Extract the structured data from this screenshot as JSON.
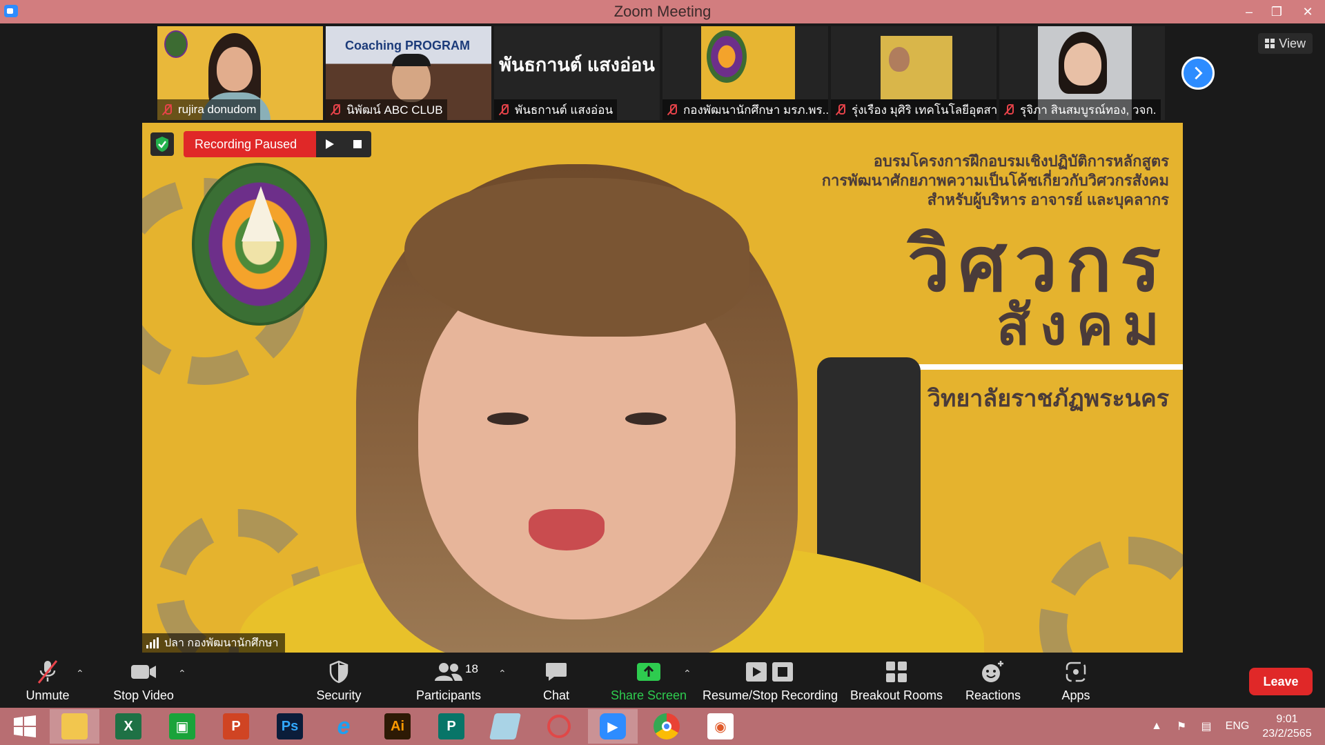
{
  "window": {
    "title": "Zoom Meeting"
  },
  "gallery": {
    "participants": [
      {
        "name": "rujira donudom"
      },
      {
        "name": "นิพัฒน์ ABC CLUB",
        "tile_text": "Coaching PROGRAM"
      },
      {
        "name": "พันธกานต์ แสงอ่อน",
        "big_name": "พันธกานต์ แสงอ่อน"
      },
      {
        "name": "กองพัฒนานักศึกษา มรภ.พร..."
      },
      {
        "name": "รุ่งเรือง มุศิริ เทคโนโลยีอุตสา..."
      },
      {
        "name": "รุจิภา สินสมบูรณ์ทอง, วจก."
      }
    ],
    "view_label": "View"
  },
  "recording": {
    "status": "Recording Paused"
  },
  "main": {
    "speaker": "ปลา กองพัฒนานักศึกษา",
    "slide_line1": "อบรมโครงการฝึกอบรมเชิงปฏิบัติการหลักสูตร",
    "slide_line2": "การพัฒนาศักยภาพความเป็นโค้ชเกี่ยวกับวิศวกรสังคม",
    "slide_line3": "สำหรับผู้บริหาร อาจารย์ และบุคลากร",
    "slide_big1": "วิศวกร",
    "slide_big2": "สังคม",
    "slide_uni": "วิทยาลัยราชภัฏพระนคร"
  },
  "toolbar": {
    "unmute": "Unmute",
    "stop_video": "Stop Video",
    "security": "Security",
    "participants": "Participants",
    "participants_count": "18",
    "chat": "Chat",
    "share_screen": "Share Screen",
    "recording": "Resume/Stop Recording",
    "breakout": "Breakout Rooms",
    "reactions": "Reactions",
    "apps": "Apps",
    "leave": "Leave"
  },
  "taskbar": {
    "lang": "ENG",
    "time": "9:01",
    "date": "23/2/2565"
  },
  "colors": {
    "accent": "#2d8cff",
    "leave": "#e02828",
    "share": "#2ecc4f",
    "titlebar": "#d27d7f"
  }
}
